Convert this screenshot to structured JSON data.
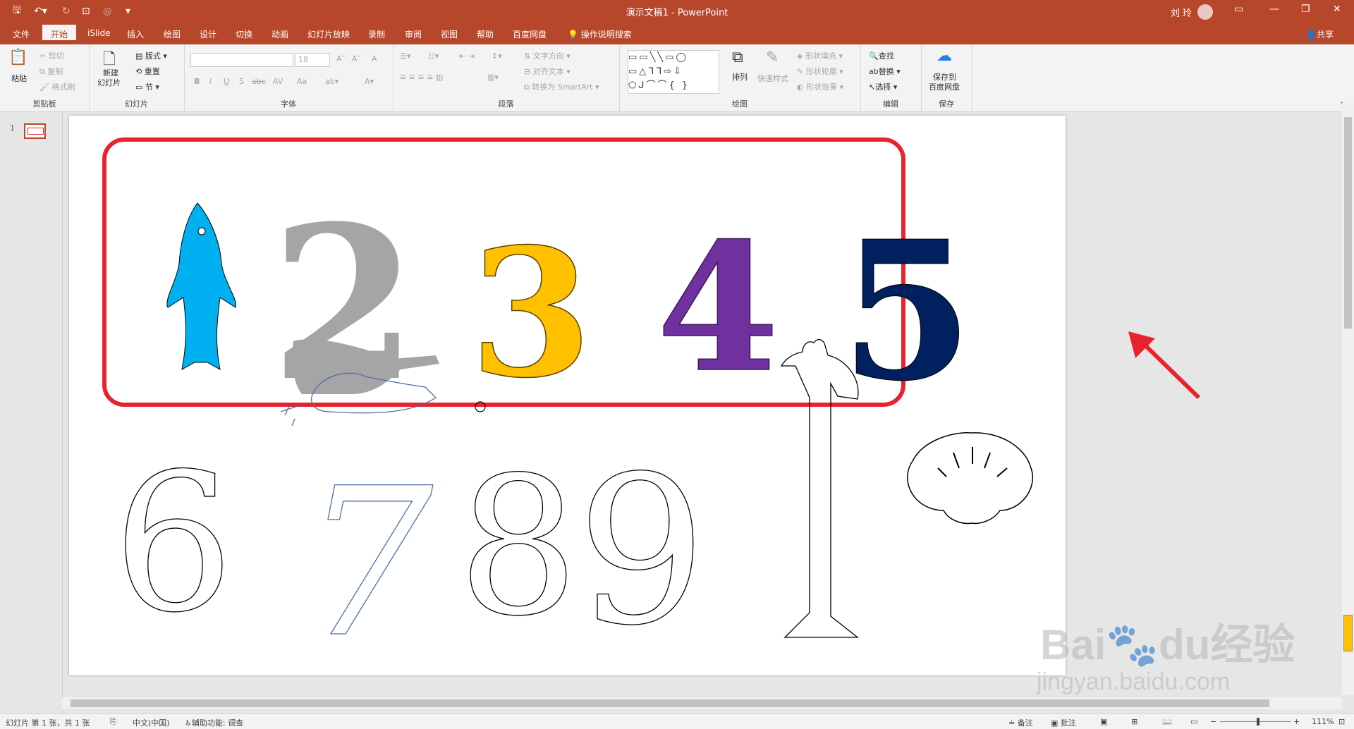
{
  "window": {
    "title": "演示文稿1 - PowerPoint",
    "user_name": "刘 玲",
    "share_label": "共享"
  },
  "tabs": [
    "文件",
    "开始",
    "iSlide",
    "插入",
    "绘图",
    "设计",
    "切换",
    "动画",
    "幻灯片放映",
    "录制",
    "审阅",
    "视图",
    "帮助",
    "百度网盘"
  ],
  "active_tab": "开始",
  "tell_me": "操作说明搜索",
  "ribbon": {
    "clipboard": {
      "label": "剪贴板",
      "paste": "粘贴",
      "cut": "剪切",
      "copy": "复制",
      "format_painter": "格式刷"
    },
    "slides": {
      "label": "幻灯片",
      "new_slide_line1": "新建",
      "new_slide_line2": "幻灯片",
      "layout": "版式",
      "reset": "重置",
      "section": "节"
    },
    "font": {
      "label": "字体",
      "size": "18",
      "bold": "B",
      "italic": "I",
      "underline": "U",
      "shadow": "S",
      "strike": "abc",
      "spacing": "AV",
      "case": "Aa",
      "increase": "A",
      "decrease": "A",
      "clear": "A"
    },
    "paragraph": {
      "label": "段落",
      "text_direction": "文字方向",
      "align_text": "对齐文本",
      "smartart": "转换为 SmartArt"
    },
    "drawing": {
      "label": "绘图",
      "arrange": "排列",
      "quick_styles": "快速样式",
      "shape_fill": "形状填充",
      "shape_outline": "形状轮廓",
      "shape_effects": "形状效果"
    },
    "editing": {
      "label": "编辑",
      "find": "查找",
      "replace": "替换",
      "select": "选择"
    },
    "save": {
      "label": "保存",
      "save_to_line1": "保存到",
      "save_to_line2": "百度网盘"
    }
  },
  "thumbnail_number": "1",
  "slide_content": {
    "row1": [
      "1",
      "2",
      "3",
      "4",
      "5"
    ],
    "row1_colors": [
      "#00b0f0",
      "#a5a5a5",
      "#ffc000",
      "#7030a0",
      "#002060"
    ],
    "row2": [
      "6",
      "7",
      "8",
      "9"
    ],
    "highlight_color": "#e8232d"
  },
  "statusbar": {
    "slide_info": "幻灯片 第 1 张，共 1 张",
    "language": "中文(中国)",
    "accessibility": "辅助功能: 调查",
    "notes": "备注",
    "comments": "批注",
    "zoom": "111%"
  },
  "watermark": {
    "brand": "Bai",
    "brand2": "du",
    "cn": "经验",
    "url": "jingyan.baidu.com"
  }
}
